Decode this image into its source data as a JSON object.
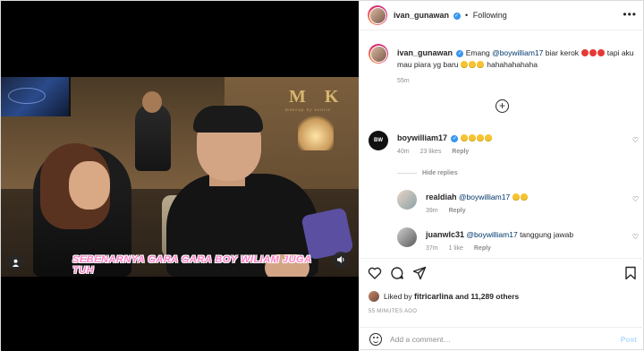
{
  "post": {
    "author": "ivan_gunawan",
    "follow_status": "Following",
    "more_label": "•••",
    "caption_prefix": "Emang ",
    "caption_mention": "@boywilliam17",
    "caption_mid": " biar kerok ",
    "caption_mid2": " tapi aku mau piara yg baru ",
    "caption_suffix": " hahahahahaha",
    "caption_time": "55m",
    "load_more_label": "+",
    "likes_prefix": "Liked by ",
    "likes_user": "fitricarlina",
    "likes_suffix": " and 11,289 others",
    "posted_ago": "55 MINUTES AGO"
  },
  "media": {
    "watermark": "M K",
    "watermark_sub": "makeup by kenzie",
    "subtitle": "SEBENARNYA GARA GARA BOY WILIAM JUGA TUH"
  },
  "comments": [
    {
      "username": "boywilliam17",
      "avatar_text": "BW",
      "time": "40m",
      "likes": "23 likes",
      "reply_label": "Reply"
    }
  ],
  "hide_replies_label": "Hide replies",
  "replies": [
    {
      "username": "realdiah",
      "mention": "@boywilliam17",
      "text": "",
      "time": "39m",
      "likes": "",
      "reply_label": "Reply"
    },
    {
      "username": "juanwlc31",
      "mention": "@boywilliam17",
      "text": " tanggung jawab",
      "time": "37m",
      "likes": "1 like",
      "reply_label": "Reply"
    }
  ],
  "add_comment": {
    "placeholder": "Add a comment…",
    "post_label": "Post"
  },
  "colors": {
    "accent_link": "#00376b",
    "verified": "#3897f0",
    "muted": "#8e8e8e",
    "subtitle_pink": "#ff7fc8"
  }
}
